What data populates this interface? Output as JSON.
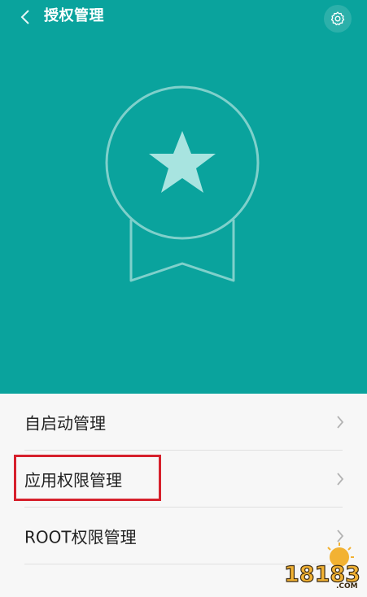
{
  "header": {
    "title": "授权管理",
    "back_icon": "chevron-left-icon",
    "settings_icon": "gear-icon"
  },
  "hero": {
    "background_color": "#0aa39d",
    "badge_icon": "award-badge-icon",
    "star_color": "#a8e4e0"
  },
  "list": {
    "items": [
      {
        "label": "自启动管理"
      },
      {
        "label": "应用权限管理",
        "highlighted": true
      },
      {
        "label": "ROOT权限管理"
      }
    ],
    "chevron_icon": "chevron-right-icon"
  },
  "highlight": {
    "color": "#d6202c"
  },
  "watermark": {
    "text": "18183",
    "subtext": ".COM"
  }
}
